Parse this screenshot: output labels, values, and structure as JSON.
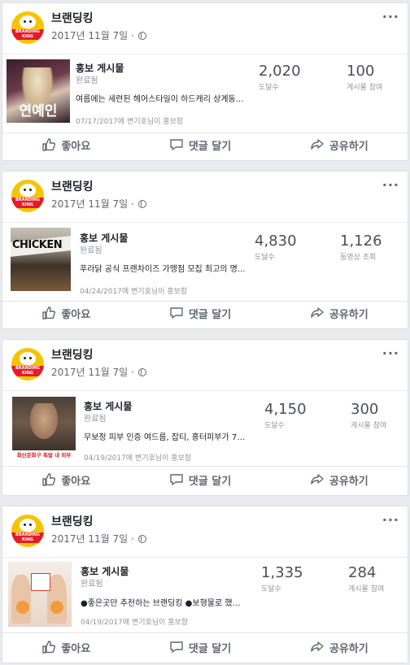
{
  "posts": [
    {
      "page_name": "브랜딩킹",
      "post_date": "2017년 11월 7일 ·",
      "promo": {
        "title": "홍보 게시물",
        "status": "완료됨",
        "description": "여름에는 세련된 헤어스타일이 하드캐리 상계동...",
        "date_line": "07/17/2017에 변기호님이 홍보함",
        "thumb_label": "연예인"
      },
      "stat1": {
        "value": "2,020",
        "label": "도달수"
      },
      "stat2": {
        "value": "100",
        "label": "게시물 참여"
      },
      "actions": {
        "like": "좋아요",
        "comment": "댓글 달기",
        "share": "공유하기"
      }
    },
    {
      "page_name": "브랜딩킹",
      "post_date": "2017년 11월 7일 ·",
      "promo": {
        "title": "홍보 게시물",
        "status": "완료됨",
        "description": "푸라닭 공식 프랜차이즈 가맹점 모집 최고의 명...",
        "date_line": "04/24/2017에 변기호님이 홍보함",
        "thumb_label": "CHICKEN"
      },
      "stat1": {
        "value": "4,830",
        "label": "도달수"
      },
      "stat2": {
        "value": "1,126",
        "label": "동영상 조회"
      },
      "actions": {
        "like": "좋아요",
        "comment": "댓글 달기",
        "share": "공유하기"
      }
    },
    {
      "page_name": "브랜딩킹",
      "post_date": "2017년 11월 7일 ·",
      "promo": {
        "title": "홍보 게시물",
        "status": "완료됨",
        "description": "무보정 피부 인증 여드름, 잡티, 홍터피부가 7일...",
        "date_line": "04/19/2017에 변기호님이 홍보함",
        "thumb_label": "화산문화구 독발 내 피부"
      },
      "stat1": {
        "value": "4,150",
        "label": "도달수"
      },
      "stat2": {
        "value": "300",
        "label": "게시물 참여"
      },
      "actions": {
        "like": "좋아요",
        "comment": "댓글 달기",
        "share": "공유하기"
      }
    },
    {
      "page_name": "브랜딩킹",
      "post_date": "2017년 11월 7일 ·",
      "promo": {
        "title": "홍보 게시물",
        "status": "완료됨",
        "description": "●좋은곳만 추천하는 브랜딩킹 ●보형물로 했던 ...",
        "date_line": "04/19/2017에 변기호님이 홍보함",
        "thumb_label": ""
      },
      "stat1": {
        "value": "1,335",
        "label": "도달수"
      },
      "stat2": {
        "value": "284",
        "label": "게시물 참여"
      },
      "actions": {
        "like": "좋아요",
        "comment": "댓글 달기",
        "share": "공유하기"
      }
    }
  ],
  "logo_text": "BRANDING KING",
  "colors": {
    "page_bg": "#e9ebee",
    "card_bg": "#ffffff",
    "text": "#1d2129",
    "muted": "#616770",
    "logo_yellow": "#f5c400"
  },
  "icons": {
    "like": "thumbs-up-icon",
    "comment": "comment-icon",
    "share": "share-arrow-icon",
    "privacy": "globe-icon",
    "more": "more-dots-icon"
  }
}
